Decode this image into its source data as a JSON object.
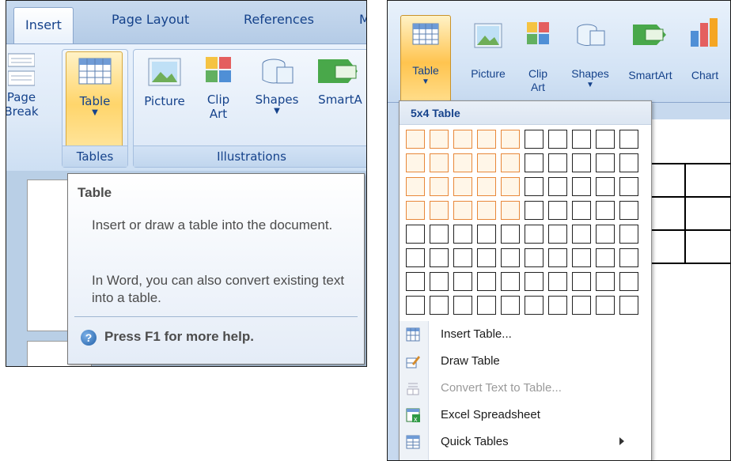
{
  "left": {
    "tabs": [
      "Insert",
      "Page Layout",
      "References",
      "M"
    ],
    "buttons": {
      "page_break": [
        "Page",
        "Break"
      ],
      "table": "Table",
      "picture": "Picture",
      "clip_art": [
        "Clip",
        "Art"
      ],
      "shapes": "Shapes",
      "smartart": "SmartA"
    },
    "groups": {
      "tables": "Tables",
      "illustrations": "Illustrations"
    },
    "tooltip": {
      "title": "Table",
      "body1": "Insert or draw a table into the document.",
      "body2": "In Word, you can also convert existing text into a table.",
      "help": "Press F1 for more help."
    }
  },
  "right": {
    "buttons": {
      "table": "Table",
      "picture": "Picture",
      "clip_art": [
        "Clip",
        "Art"
      ],
      "shapes": "Shapes",
      "smartart": "SmartArt",
      "chart": "Chart"
    },
    "dropdown": {
      "header": "5x4 Table",
      "grid": {
        "cols": 10,
        "rows": 8,
        "selected_cols": 5,
        "selected_rows": 4
      },
      "items": [
        {
          "label": "Insert Table...",
          "icon": "insert-table-icon",
          "enabled": true
        },
        {
          "label": "Draw Table",
          "icon": "draw-table-icon",
          "enabled": true
        },
        {
          "label": "Convert Text to Table...",
          "icon": "convert-text-icon",
          "enabled": false
        },
        {
          "label": "Excel Spreadsheet",
          "icon": "excel-spreadsheet-icon",
          "enabled": true
        },
        {
          "label": "Quick Tables",
          "icon": "quick-tables-icon",
          "enabled": true,
          "submenu": true
        }
      ]
    }
  }
}
